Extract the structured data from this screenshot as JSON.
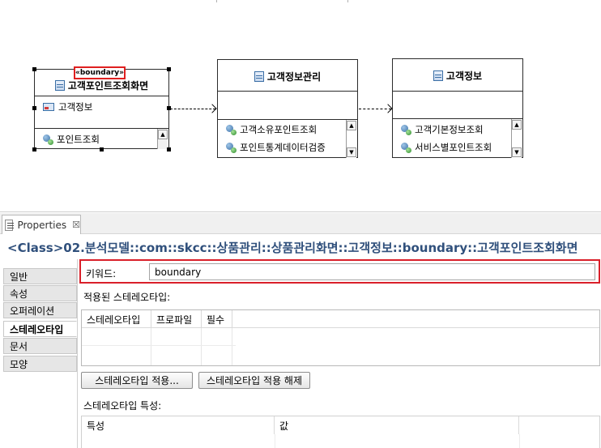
{
  "diagram": {
    "classes": [
      {
        "stereotype": "«boundary»",
        "name": "고객포인트조회화면",
        "attributes": [
          "고객정보"
        ],
        "operations": [
          "포인트조회"
        ]
      },
      {
        "name": "고객정보관리",
        "operations": [
          "고객소유포인트조회",
          "포인트통계데이터검증"
        ]
      },
      {
        "name": "고객정보",
        "operations": [
          "고객기본정보조회",
          "서비스별포인트조회"
        ]
      }
    ],
    "icons": {
      "class": "class-icon",
      "attribute": "attribute-icon",
      "operation": "operation-icon"
    },
    "colors": {
      "highlight": "#e02020"
    }
  },
  "properties": {
    "tab_label": "Properties",
    "tab_close": "☒",
    "title": "<Class>02.분석모델::com::skcc::상품관리::상품관리화면::고객정보::boundary::고객포인트조회화면",
    "side_tabs": [
      "일반",
      "속성",
      "오퍼레이션",
      "스테레오타입",
      "문서",
      "모양"
    ],
    "active_tab": "스테레오타입",
    "keyword_label": "키워드:",
    "keyword_value": "boundary",
    "applied_label": "적용된 스테레오타입:",
    "applied_columns": [
      "스테레오타입",
      "프로파일",
      "필수"
    ],
    "buttons": {
      "apply": "스테레오타입 적용...",
      "remove": "스테레오타입 적용 해제"
    },
    "attributes_label": "스테레오타입 특성:",
    "attribute_columns": [
      "특성",
      "값"
    ],
    "colors": {
      "title": "#30507c",
      "highlight": "#d9202a"
    }
  }
}
